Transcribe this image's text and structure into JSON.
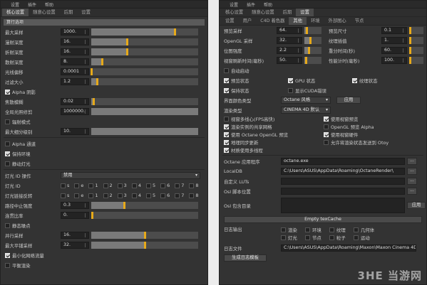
{
  "left": {
    "menu": [
      "设置",
      "插件",
      "帮助"
    ],
    "tabs": [
      "核心设置",
      "随意心设置",
      "后期",
      "设置"
    ],
    "group_header": "算行选项",
    "numeric_rows": [
      {
        "label": "最大采样",
        "value": "1000.",
        "slider": 0.78
      },
      {
        "label": "漫射深度",
        "value": "16.",
        "slider": 0.33
      },
      {
        "label": "折射深度",
        "value": "16.",
        "slider": 0.33
      },
      {
        "label": "散射深度",
        "value": "8.",
        "slider": 0.1
      },
      {
        "label": "光线偏移",
        "value": "0.0001",
        "slider": 0.0
      },
      {
        "label": "过滤大小",
        "value": "1.2",
        "slider": 0.05
      }
    ],
    "alpha_shadow": {
      "label": "Alpha 阴影",
      "checked": true
    },
    "numeric_rows2": [
      {
        "label": "焦散模糊",
        "value": "0.02",
        "slider": 0.02
      },
      {
        "label": "全局光照修剪",
        "value": "1000000.",
        "slider": 1.0
      }
    ],
    "radiance_mode": {
      "label": "辐射模式",
      "checked": false
    },
    "max_subdivision": {
      "label": "最大细分级别",
      "value": "10.",
      "slider": 1.0
    },
    "alpha_channel": {
      "label": "Alpha 通道",
      "checked": false
    },
    "keep_env": {
      "label": "保持环境",
      "checked": true
    },
    "static_noise": {
      "label": "静动灯光",
      "checked": false
    },
    "light_id_action": {
      "label": "灯光 ID 操作",
      "value": "禁用"
    },
    "light_id_rows": [
      {
        "label": "灯光 ID",
        "ids": [
          "s",
          "e",
          "1",
          "2",
          "3",
          "4",
          "5",
          "6",
          "7",
          "8"
        ]
      },
      {
        "label": "灯光链接反转",
        "ids": [
          "s",
          "e",
          "1",
          "2",
          "3",
          "4",
          "5",
          "6",
          "7",
          "8"
        ]
      }
    ],
    "path_term": {
      "label": "路径中止强度",
      "value": "0.3",
      "slider": 0.3
    },
    "coherent": {
      "label": "连贯比率",
      "value": "0.",
      "slider": 0.0
    },
    "static_noise2": {
      "label": "静态噪点",
      "checked": false
    },
    "numeric_rows3": [
      {
        "label": "并行采样",
        "value": "16.",
        "slider": 0.5
      },
      {
        "label": "最大平铺采样",
        "value": "32.",
        "slider": 0.5
      }
    ],
    "minimize_net": {
      "label": "最小化网络流量",
      "checked": true
    },
    "deep_image": {
      "label": "平衡渲染",
      "checked": false
    }
  },
  "right": {
    "menu": [
      "设置",
      "插件",
      "帮助"
    ],
    "tabs": [
      "核心设置",
      "随意心设置",
      "后期",
      "设置"
    ],
    "subtabs": [
      "设置",
      "用户",
      "C4D 着色器",
      "其他",
      "环境",
      "外部图心",
      "节点"
    ],
    "active_subtab": "其他",
    "pair_rows": [
      {
        "l_label": "预览采样",
        "l_value": "64.",
        "l_slider": 0.1,
        "r_label": "预览尺寸",
        "r_value": "0.1"
      },
      {
        "l_label": "OpenGL 采样",
        "l_value": "32.",
        "l_slider": 0.3,
        "r_label": "纹理插值",
        "r_value": "1."
      },
      {
        "l_label": "位图强度",
        "l_value": "2.2",
        "l_slider": 0.22,
        "r_label": "重分时间(秒)",
        "r_value": "60."
      },
      {
        "l_label": "视窗刷新时间(毫秒)",
        "l_value": "50.",
        "l_slider": 0.05,
        "r_label": "性能计时(毫秒)",
        "r_value": "100."
      }
    ],
    "auto_start": {
      "label": "自动启动",
      "checked": false
    },
    "status_row1": [
      {
        "label": "预览状态",
        "checked": true
      },
      {
        "label": "GPU 状态",
        "checked": true
      },
      {
        "label": "纹理状态",
        "checked": true
      }
    ],
    "status_row2": [
      {
        "label": "保持状态",
        "checked": true
      },
      {
        "label": "显示CUDA错误",
        "checked": false
      }
    ],
    "ui_color": {
      "label": "界面颜色类型",
      "value": "Octane 风格",
      "button": "应用"
    },
    "render_type": {
      "label": "渲染类型",
      "value": "CINEMA 4D 默认"
    },
    "option_pairs": [
      [
        {
          "label": "视窗多线心(FPS高快)",
          "checked": false
        },
        {
          "label": "使用视窗预览",
          "checked": true
        }
      ],
      [
        {
          "label": "渲染实例的共享网格",
          "checked": true
        },
        {
          "label": "OpenGL 预览 Alpha",
          "checked": false
        }
      ],
      [
        {
          "label": "使用 Octane OpenGL 预览",
          "checked": true
        },
        {
          "label": "使用视窗硬件",
          "checked": true
        }
      ],
      [
        {
          "label": "地理同步更新",
          "checked": true
        },
        {
          "label": "允许将渲染状态发送到 Otoy",
          "checked": false
        }
      ],
      [
        {
          "label": "材质使用多线程",
          "checked": true
        },
        {
          "label": "",
          "checked": false
        }
      ]
    ],
    "octane_app": {
      "label": "Octane 应用程序",
      "value": "octane.exe"
    },
    "localdb": {
      "label": "LocalDB",
      "value": "C:\\Users\\ASUS\\AppData\\Roaming\\OctaneRender\\"
    },
    "custom_luts": {
      "label": "自定义 LUTs",
      "value": ""
    },
    "osl_script": {
      "label": "Osl 脚本位置",
      "value": ""
    },
    "osl_include": {
      "label": "Osl 包含目录",
      "value": "",
      "button": "应用"
    },
    "empty_cache": "Empty texCache",
    "log_output": {
      "label": "日志输出",
      "row1": [
        {
          "label": "渲染",
          "checked": false
        },
        {
          "label": "环境",
          "checked": false
        },
        {
          "label": "纹理",
          "checked": false
        },
        {
          "label": "几何体",
          "checked": false
        }
      ],
      "row2": [
        {
          "label": "灯光",
          "checked": false
        },
        {
          "label": "节点",
          "checked": false
        },
        {
          "label": "粒子",
          "checked": false
        },
        {
          "label": "运动",
          "checked": false
        }
      ]
    },
    "log_file": {
      "label": "日志文件",
      "value": "C:\\Users\\ASUS\\AppData\\Roaming\\Maxon\\Maxon Cinema 4D R"
    },
    "bottom_btn": "生成日志模板",
    "watermark": "3HE 当游网"
  }
}
